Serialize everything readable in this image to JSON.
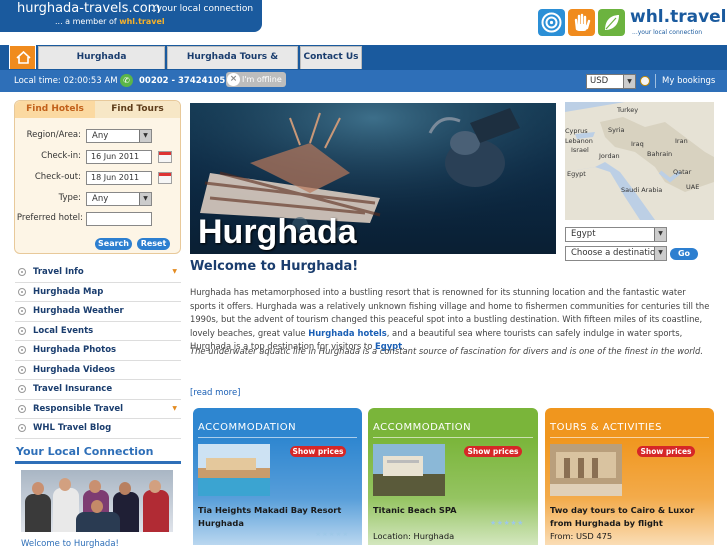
{
  "header": {
    "site_name": "hurghada-travels.com",
    "site_tagline": "...your local connection",
    "member_prefix": "... a member of ",
    "member_brand": "whl.travel",
    "brand_name": "whl.travel",
    "brand_tagline": "...your local connection"
  },
  "nav": {
    "tabs": [
      {
        "label": "Hurghada Accommodation"
      },
      {
        "label": "Hurghada Tours & Activities"
      },
      {
        "label": "Contact Us"
      }
    ]
  },
  "infobar": {
    "local_time": "Local time: 02:00:53 AM",
    "phone": "00202 - 37424105",
    "offline_label": "I'm offline",
    "currency": "USD",
    "my_bookings": "My bookings"
  },
  "search": {
    "tab_hotels": "Find Hotels",
    "tab_tours": "Find Tours",
    "region_label": "Region/Area:",
    "region_value": "Any",
    "checkin_label": "Check-in:",
    "checkin_value": "16 Jun 2011",
    "checkout_label": "Check-out:",
    "checkout_value": "18 Jun 2011",
    "type_label": "Type:",
    "type_value": "Any",
    "preferred_label": "Preferred hotel:",
    "preferred_value": "",
    "search_button": "Search",
    "reset_button": "Reset"
  },
  "sidenav": {
    "items": [
      {
        "label": "Travel Info",
        "dropdown": true
      },
      {
        "label": "Hurghada Map",
        "dropdown": false
      },
      {
        "label": "Hurghada Weather",
        "dropdown": false
      },
      {
        "label": "Local Events",
        "dropdown": false
      },
      {
        "label": "Hurghada Photos",
        "dropdown": false
      },
      {
        "label": "Hurghada Videos",
        "dropdown": false
      },
      {
        "label": "Travel Insurance",
        "dropdown": false
      },
      {
        "label": "Responsible Travel",
        "dropdown": true
      },
      {
        "label": "WHL Travel Blog",
        "dropdown": false
      }
    ]
  },
  "local_connection": {
    "title": "Your Local Connection",
    "link": "Welcome to Hurghada!"
  },
  "hero": {
    "title": "Hurghada"
  },
  "map": {
    "labels": [
      "Turkey",
      "Cyprus",
      "Syria",
      "Lebanon",
      "Israel",
      "Iraq",
      "Iran",
      "Jordan",
      "Bahrain",
      "Egypt",
      "Qatar",
      "UAE",
      "Saudi Arabia"
    ]
  },
  "destination": {
    "country": "Egypt",
    "choose": "Choose a destination",
    "go": "Go"
  },
  "main": {
    "welcome_title": "Welcome to Hurghada!",
    "intro_a": "Hurghada has metamorphosed into a bustling resort that is renowned for its stunning location and the fantastic water sports it offers. Hurghada was a relatively unknown fishing village and home to fishermen communities for centuries till the 1990s, but the advent of tourism changed this peaceful spot into a bustling destination. With fifteen miles of its coastline, lovely beaches, great value ",
    "intro_link1": "Hurghada hotels",
    "intro_b": ", and a beautiful sea where tourists can safely indulge in water sports, Hurghada is a top destination for visitors to ",
    "intro_link2": "Egypt",
    "intro_c": ".",
    "intro2": "The underwater aquatic life in Hurghada is a constant source of fascination for divers and is one of the finest in the world.",
    "read_more": "[read more]"
  },
  "cards": [
    {
      "heading": "ACCOMMODATION",
      "show_prices": "Show prices",
      "title": "Tia Heights Makadi Bay Resort Hurghada",
      "subtitle": "",
      "color": "#2e86d0"
    },
    {
      "heading": "ACCOMMODATION",
      "show_prices": "Show prices",
      "title": "Titanic Beach SPA",
      "subtitle": "Location: Hurghada",
      "color": "#7ab53a"
    },
    {
      "heading": "TOURS & ACTIVITIES",
      "show_prices": "Show prices",
      "title": "Two day tours to Cairo & Luxor from Hurghada by flight",
      "subtitle": "From: USD 475",
      "color": "#f0961e"
    }
  ],
  "colors": {
    "brand_blue": "#1a5a9e",
    "accent_orange": "#f08b1d",
    "link_blue": "#1a5fb5"
  }
}
